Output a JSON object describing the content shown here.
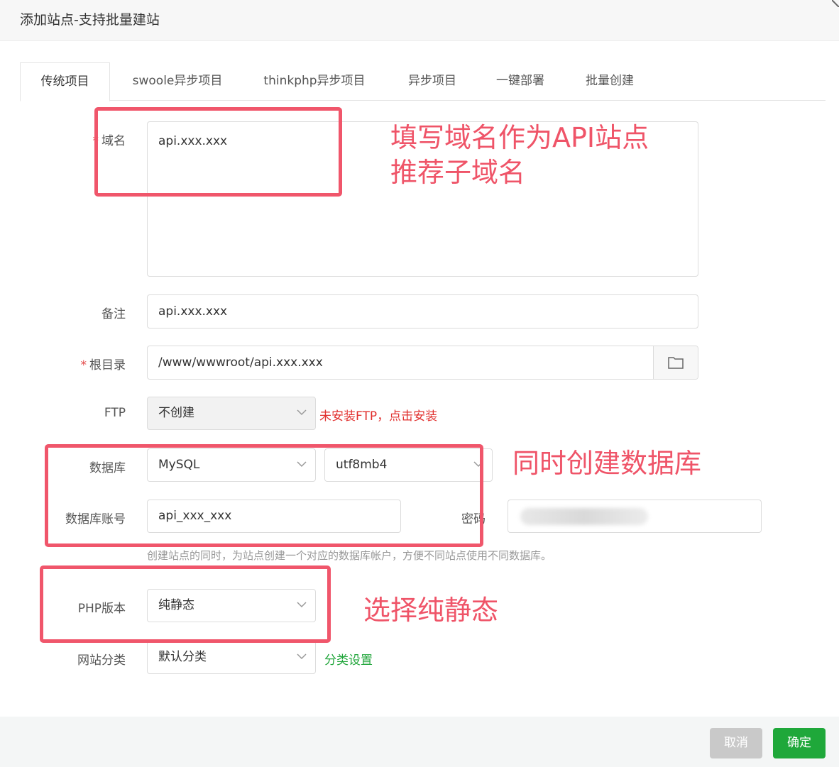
{
  "dialog": {
    "title": "添加站点-支持批量建站"
  },
  "tabs": [
    {
      "label": "传统项目",
      "active": true
    },
    {
      "label": "swoole异步项目"
    },
    {
      "label": "thinkphp异步项目"
    },
    {
      "label": "异步项目"
    },
    {
      "label": "一键部署"
    },
    {
      "label": "批量创建"
    }
  ],
  "form": {
    "required_mark": "*",
    "domain": {
      "label": "域名",
      "value": "api.xxx.xxx"
    },
    "remark": {
      "label": "备注",
      "value": "api.xxx.xxx"
    },
    "root": {
      "label": "根目录",
      "value": "/www/wwwroot/api.xxx.xxx"
    },
    "ftp": {
      "label": "FTP",
      "value": "不创建",
      "note": "未安装FTP，点击安装"
    },
    "database": {
      "label": "数据库",
      "type": "MySQL",
      "charset": "utf8mb4"
    },
    "db_account": {
      "label": "数据库账号",
      "value": "api_xxx_xxx"
    },
    "db_password": {
      "label": "密码"
    },
    "db_hint": "创建站点的同时，为站点创建一个对应的数据库帐户，方便不同站点使用不同数据库。",
    "php_version": {
      "label": "PHP版本",
      "value": "纯静态"
    },
    "category": {
      "label": "网站分类",
      "value": "默认分类",
      "link": "分类设置"
    }
  },
  "annotations": {
    "domain_line1": "填写域名作为API站点",
    "domain_line2": "推荐子域名",
    "database": "同时创建数据库",
    "php": "选择纯静态"
  },
  "footer": {
    "cancel": "取消",
    "confirm": "确定"
  },
  "colors": {
    "annotation": "#f0566b",
    "confirm_button": "#1fa83a",
    "note_red": "#e1302e",
    "link_green": "#20a53a"
  }
}
